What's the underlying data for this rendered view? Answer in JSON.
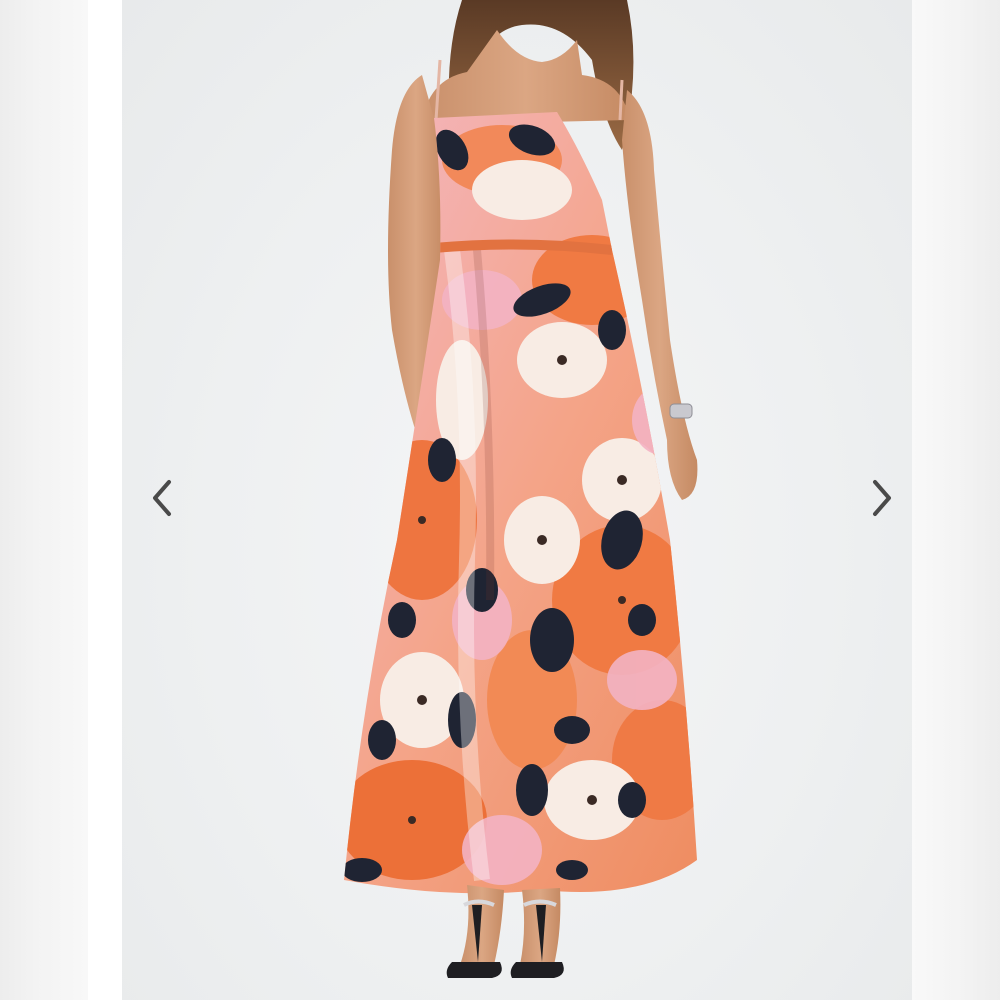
{
  "gallery": {
    "prev_icon": "chevron-left-icon",
    "next_icon": "chevron-right-icon",
    "arrow_color": "#4a4a4a",
    "background_color": "#eef0f1"
  },
  "product": {
    "dress_colors": {
      "orange": "#f07a43",
      "pink": "#f2b5c4",
      "cream": "#f7e9e2",
      "navy": "#1f2433"
    }
  }
}
